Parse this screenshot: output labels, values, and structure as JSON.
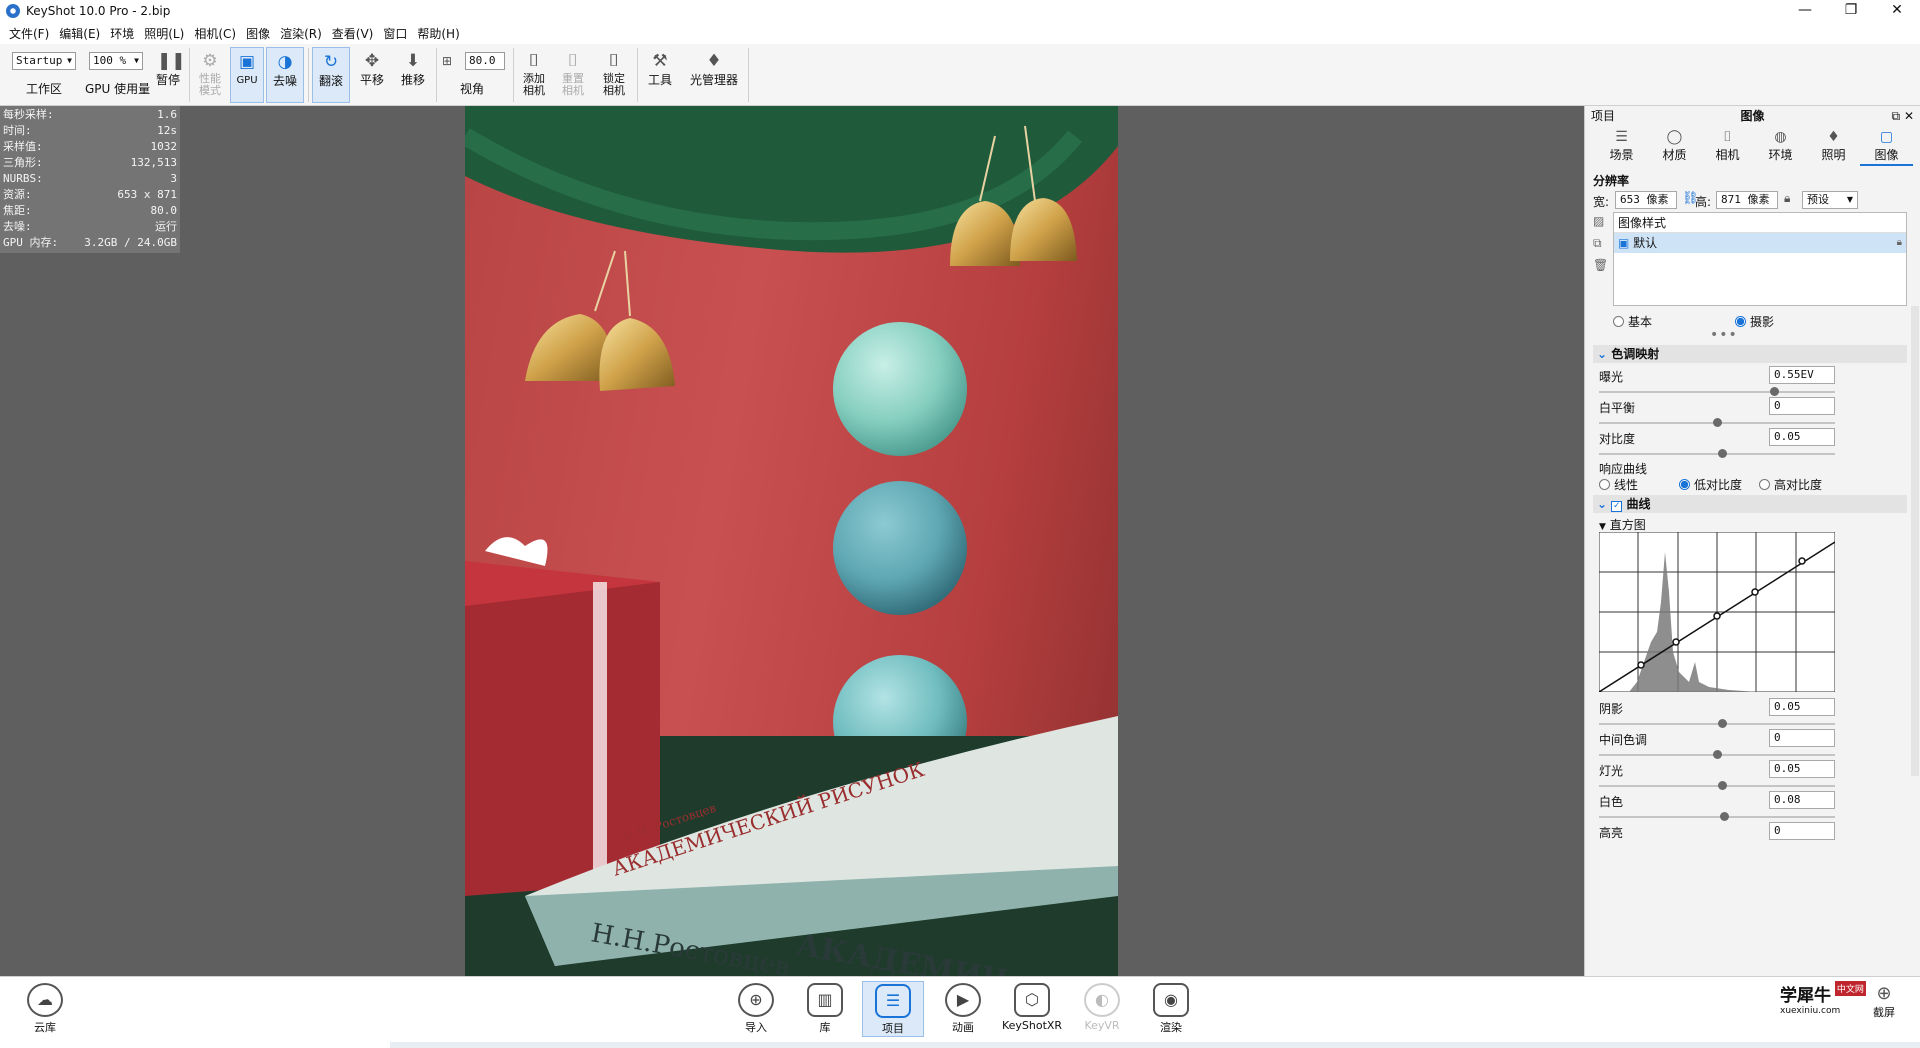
{
  "window": {
    "title": "KeyShot 10.0 Pro  - 2.bip",
    "minimize": "—",
    "maximize": "❐",
    "close": "✕"
  },
  "menu": [
    "文件(F)",
    "编辑(E)",
    "环境",
    "照明(L)",
    "相机(C)",
    "图像",
    "渲染(R)",
    "查看(V)",
    "窗口",
    "帮助(H)"
  ],
  "toolbar": {
    "workspace_value": "Startup",
    "workspace_label": "工作区",
    "cpu_usage_value": "100 %",
    "cpu_usage_label": "GPU 使用量",
    "pause_label": "暂停",
    "perf_mode_label": "性能\n模式",
    "gpu_label": "GPU",
    "denoise_label": "去噪",
    "tumble_label": "翻滚",
    "pan_label": "平移",
    "dolly_label": "推移",
    "fov_value": "80.0",
    "fov_label": "视角",
    "add_camera_label": "添加\n相机",
    "reset_camera_label": "重置\n相机",
    "lock_camera_label": "锁定\n相机",
    "tools_label": "工具",
    "light_manager_label": "光管理器"
  },
  "hud": [
    {
      "k": "每秒采样:",
      "v": "1.6"
    },
    {
      "k": "时间:",
      "v": "12s"
    },
    {
      "k": "采样值:",
      "v": "1032"
    },
    {
      "k": "三角形:",
      "v": "132,513"
    },
    {
      "k": "NURBS:",
      "v": "3"
    },
    {
      "k": "资源:",
      "v": "653 x 871"
    },
    {
      "k": "焦距:",
      "v": "80.0"
    },
    {
      "k": "去噪:",
      "v": "运行"
    },
    {
      "k": "GPU 内存:",
      "v": "3.2GB / 24.0GB"
    }
  ],
  "render": {
    "book_title": "АКАДЕМИЧЕСКИЙ РИСУНОК",
    "book_author": "Н.Н. Ростовцев",
    "book_spine_author": "Н.Н.Ростовцев",
    "book_spine_title": "АКАДЕМИЧ"
  },
  "panel": {
    "header": "项目",
    "title": "图像",
    "float_icon": "⧉",
    "close_icon": "✕",
    "tabs": [
      {
        "label": "场景",
        "icon": "☰"
      },
      {
        "label": "材质",
        "icon": "◯"
      },
      {
        "label": "相机",
        "icon": "⌷"
      },
      {
        "label": "环境",
        "icon": "◍"
      },
      {
        "label": "照明",
        "icon": "♦"
      },
      {
        "label": "图像",
        "icon": "▢"
      }
    ],
    "resolution_title": "分辨率",
    "width_label": "宽:",
    "width_value": "653 像素",
    "height_label": "高:",
    "height_value": "871 像素",
    "preset_label": "预设",
    "styles_header": "图像样式",
    "style_item": "默认",
    "mode_basic": "基本",
    "mode_photo": "摄影",
    "tonemap_title": "色调映射",
    "exposure_label": "曝光",
    "exposure_value": "0.55EV",
    "exposure_level": 0.74,
    "whitebalance_label": "白平衡",
    "whitebalance_value": "0",
    "whitebalance_level": 0.5,
    "contrast_label": "对比度",
    "contrast_value": "0.05",
    "contrast_level": 0.52,
    "response_label": "响应曲线",
    "curve_linear": "线性",
    "curve_low": "低对比度",
    "curve_high": "高对比度",
    "curves_title": "曲线",
    "histogram_label": "直方图",
    "shadows_label": "阴影",
    "shadows_value": "0.05",
    "shadows_level": 0.52,
    "midtones_label": "中间色调",
    "midtones_value": "0",
    "midtones_level": 0.5,
    "lights_label": "灯光",
    "lights_value": "0.05",
    "lights_level": 0.52,
    "whites_label": "白色",
    "whites_value": "0.08",
    "whites_level": 0.53,
    "highlights_label": "高亮",
    "highlights_value": "0"
  },
  "bottom": {
    "cloud_label": "云库",
    "import_label": "导入",
    "library_label": "库",
    "project_label": "项目",
    "animation_label": "动画",
    "keyshotxr_label": "KeyShotXR",
    "keyvr_label": "KeyVR",
    "render_label": "渲染",
    "screenshot_label": "截屏",
    "watermark_cn": "学犀牛",
    "watermark_url": "xuexiniu.com",
    "watermark_badge": "中文网"
  }
}
